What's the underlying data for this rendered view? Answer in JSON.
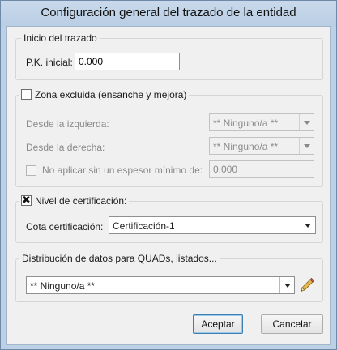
{
  "window": {
    "title": "Configuración general del trazado de la entidad"
  },
  "inicio": {
    "legend": "Inicio del trazado",
    "pk_label": "P.K. inicial:",
    "pk_value": "0.000"
  },
  "zona": {
    "checkbox_label": "Zona excluida (ensanche y mejora)",
    "checked": false,
    "izquierda_label": "Desde la izquierda:",
    "izquierda_value": "** Ninguno/a **",
    "derecha_label": "Desde la derecha:",
    "derecha_value": "** Ninguno/a **",
    "no_aplicar_label": "No aplicar sin un espesor mínimo de:",
    "espesor_value": "0.000"
  },
  "certificacion": {
    "checkbox_label": "Nivel de certificación:",
    "checked": true,
    "check_glyph": "✖",
    "cota_label": "Cota certificación:",
    "cota_value": "Certificación-1"
  },
  "quads": {
    "legend": "Distribución de datos para QUADs, listados...",
    "value": "** Ninguno/a **",
    "edit_icon": "pencil-icon"
  },
  "buttons": {
    "accept": "Aceptar",
    "cancel": "Cancelar"
  }
}
